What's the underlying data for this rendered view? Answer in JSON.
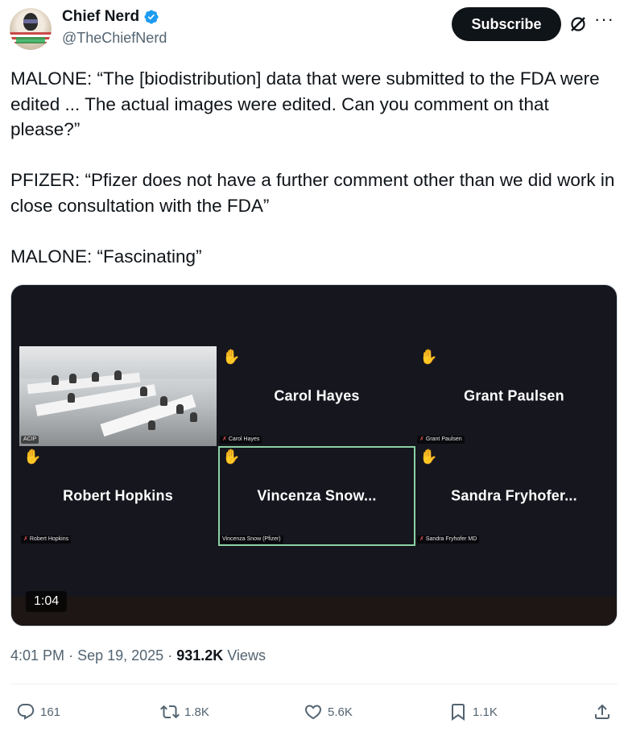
{
  "author": {
    "name": "Chief Nerd",
    "handle": "@TheChiefNerd",
    "verified": true,
    "avatar_text": "CHIEF NERD"
  },
  "subscribe_label": "Subscribe",
  "tweet": {
    "paragraphs": [
      "MALONE: “The [biodistribution] data that were submitted to the FDA were edited ... The actual images were edited. Can you comment on that please?”",
      "PFIZER: “Pfizer does not have a further comment other than we did work in close consultation with the FDA”",
      "MALONE: “Fascinating”"
    ]
  },
  "video": {
    "duration": "1:04",
    "room_tag": "ACIP",
    "tiles": [
      {
        "name": "Carol Hayes",
        "tag": "Carol Hayes"
      },
      {
        "name": "Grant Paulsen",
        "tag": "Grant Paulsen"
      },
      {
        "name": "Robert Hopkins",
        "tag": "Robert Hopkins"
      },
      {
        "name": "Vincenza  Snow...",
        "tag": "Vincenza Snow (Pfizer)"
      },
      {
        "name": "Sandra  Fryhofer...",
        "tag": "Sandra Fryhofer MD"
      }
    ]
  },
  "meta": {
    "time": "4:01 PM",
    "date": "Sep 19, 2025",
    "views_count": "931.2K",
    "views_label": "Views"
  },
  "actions": {
    "replies": "161",
    "reposts": "1.8K",
    "likes": "5.6K",
    "bookmarks": "1.1K"
  },
  "colors": {
    "text": "#0f1419",
    "muted": "#536471",
    "verified": "#1d9bf0",
    "video_bg": "#15161e",
    "active_border": "#8ed1a4"
  }
}
